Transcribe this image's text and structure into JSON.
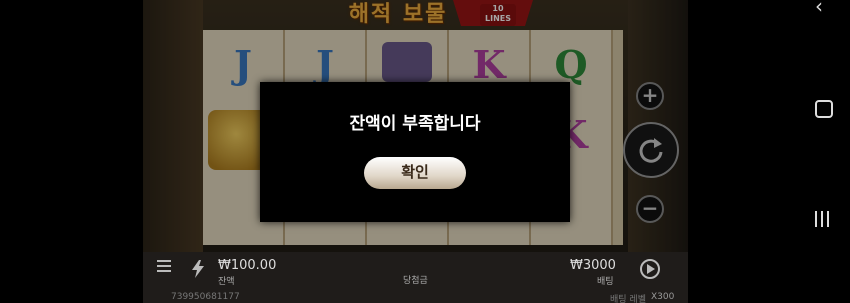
{
  "game": {
    "title": "해적 보물",
    "lines_label": "10 LINES"
  },
  "reels": {
    "symbols": [
      "J",
      "J",
      "K",
      "Q",
      "K"
    ]
  },
  "modal": {
    "message": "잔액이 부족합니다",
    "confirm_label": "확인"
  },
  "controls": {
    "plus": "+",
    "minus": "−"
  },
  "bottom": {
    "balance_value": "₩100.00",
    "balance_label": "잔액",
    "win_label": "당첨금",
    "bet_value": "₩3000",
    "bet_label": "배팅",
    "round_id": "739950681177",
    "bet_level_label": "배팅 레벨",
    "multiplier": "X300"
  },
  "colors": {
    "accent": "#f0b040",
    "modal_bg": "#000000",
    "button_bg": "#e0d6c8"
  },
  "icons": [
    "menu-icon",
    "turbo-icon",
    "autoplay-icon",
    "spin-icon",
    "plus-icon",
    "minus-icon",
    "android-back-icon",
    "android-home-icon",
    "android-recents-icon"
  ]
}
